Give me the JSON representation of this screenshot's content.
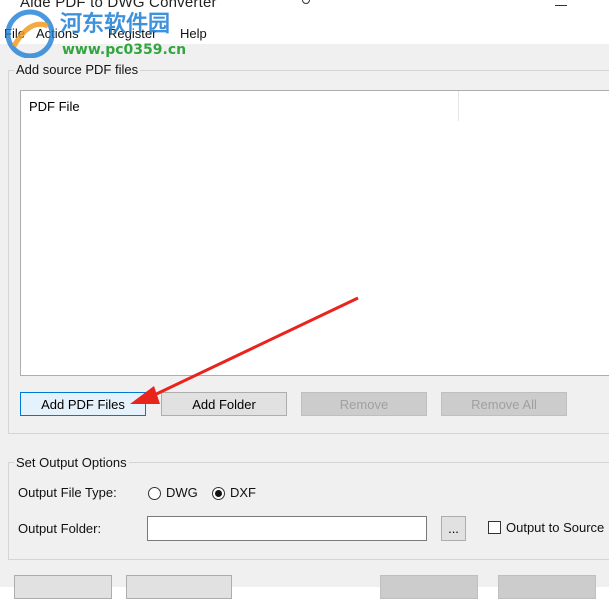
{
  "window": {
    "title": "Aide PDF to DWG Converter"
  },
  "menu": [
    "File",
    "Actions",
    "Register",
    "Help"
  ],
  "watermark": {
    "text": "河东软件园",
    "url": "www.pc0359.cn"
  },
  "source_group": {
    "label": "Add source PDF files",
    "column_header": "PDF File",
    "buttons": {
      "add_files": "Add PDF Files",
      "add_folder": "Add Folder",
      "remove": "Remove",
      "remove_all": "Remove All"
    }
  },
  "output_group": {
    "label": "Set Output Options",
    "file_type_label": "Output File Type:",
    "option_dwg": "DWG",
    "option_dxf": "DXF",
    "selected": "DXF",
    "folder_label": "Output Folder:",
    "folder_value": "",
    "browse": "...",
    "to_source_label": "Output to Source I"
  },
  "annotation": {
    "arrow_color": "#e8241c"
  }
}
